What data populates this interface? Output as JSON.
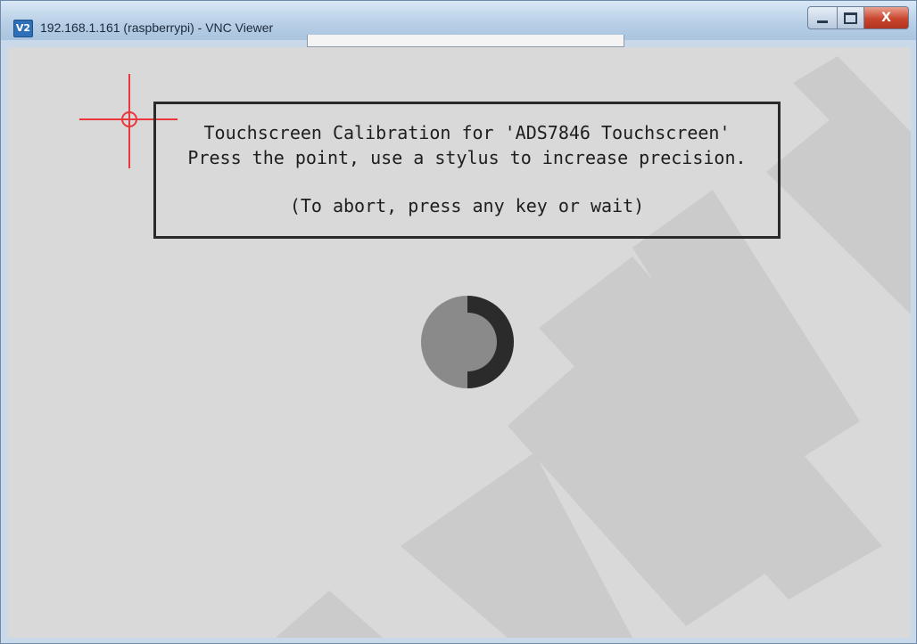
{
  "window": {
    "title": "192.168.1.161 (raspberrypi) - VNC Viewer",
    "app_icon_text": "V2",
    "app_icon": "vnc-viewer-icon",
    "controls": {
      "minimize_icon": "minimize-icon",
      "maximize_icon": "maximize-icon",
      "close_label": "X"
    }
  },
  "calibration": {
    "line1": "Touchscreen Calibration for 'ADS7846 Touchscreen'",
    "line2": "Press the point, use a stylus to increase precision.",
    "line3": "(To abort, press any key or wait)",
    "target_icon": "crosshair-target-icon",
    "target_color": "#e8383d",
    "progress_icon": "progress-spinner-icon",
    "progress_fraction": 0.5,
    "spinner_colors": {
      "fill": "#8a8a8a",
      "ring": "#2b2b2b"
    }
  },
  "colors": {
    "screen_background": "#d9d9d9",
    "watermark": "#cbcbcb",
    "titlebar": "#b8cfe6",
    "close_button": "#c9452d"
  }
}
